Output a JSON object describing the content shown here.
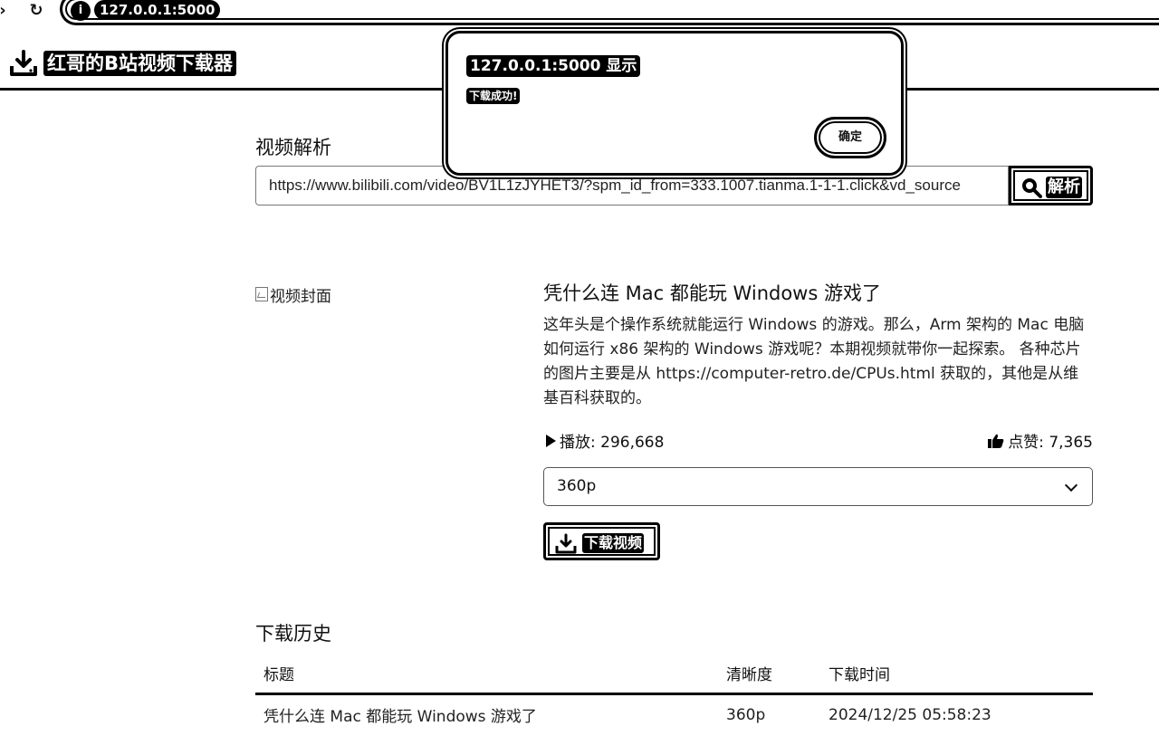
{
  "browser": {
    "url": "127.0.0.1:5000"
  },
  "app": {
    "brand": "红哥的B站视频下载器"
  },
  "dialog": {
    "title": "127.0.0.1:5000 显示",
    "message": "下载成功!",
    "ok_label": "确定"
  },
  "parse": {
    "heading": "视频解析",
    "url_value": "https://www.bilibili.com/video/BV1L1zJYHET3/?spm_id_from=333.1007.tianma.1-1-1.click&vd_source",
    "button_label": "解析"
  },
  "video": {
    "cover_alt": "视频封面",
    "title": "凭什么连 Mac 都能玩 Windows 游戏了",
    "description": "这年头是个操作系统就能运行 Windows 的游戏。那么，Arm 架构的 Mac 电脑如何运行 x86 架构的 Windows 游戏呢？本期视频就带你一起探索。 各种芯片的图片主要是从 https://computer-retro.de/CPUs.html 获取的，其他是从维基百科获取的。",
    "plays_label": "播放: 296,668",
    "likes_label": "点赞: 7,365",
    "quality_selected": "360p",
    "download_label": "下载视频"
  },
  "history": {
    "heading": "下载历史",
    "columns": [
      "标题",
      "清晰度",
      "下载时间"
    ],
    "rows": [
      {
        "title": "凭什么连 Mac 都能玩 Windows 游戏了",
        "quality": "360p",
        "time": "2024/12/25 05:58:23"
      }
    ]
  },
  "icons": {
    "back": "back-arrow-icon",
    "reload": "reload-icon",
    "site_info": "info-icon",
    "brand": "download-icon",
    "search": "search-icon",
    "play": "play-icon",
    "like": "thumbs-up-icon",
    "chevron": "chevron-down-icon",
    "download": "download-icon"
  }
}
